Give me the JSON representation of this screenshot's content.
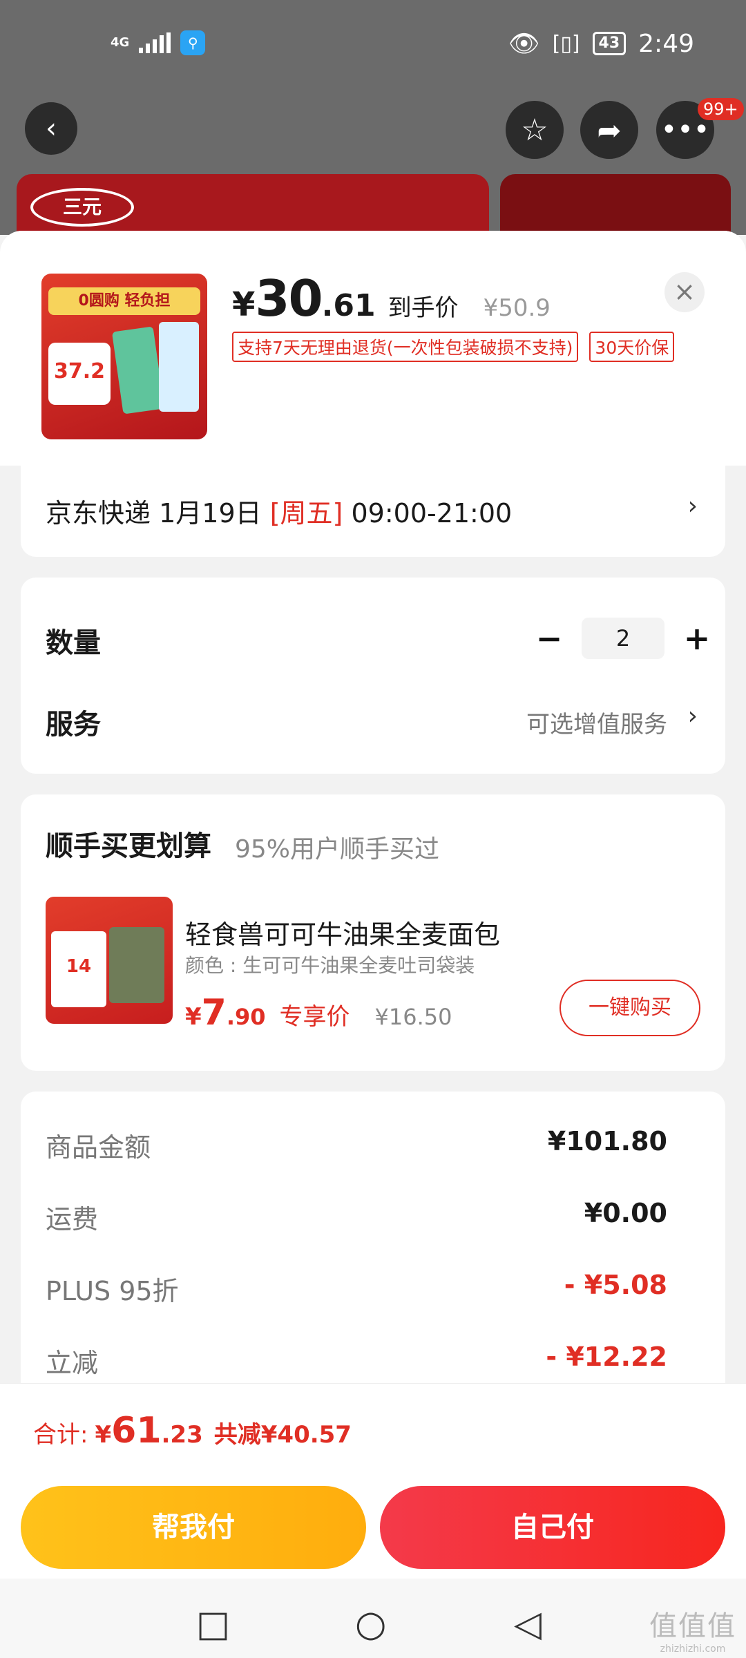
{
  "status": {
    "network": "4G",
    "battery": "43",
    "time": "2:49"
  },
  "background": {
    "badge": "99+",
    "brand": "三元"
  },
  "product": {
    "currency": "¥",
    "price_int": "30",
    "price_dec": ".61",
    "price_label": "到手价",
    "original_price": "¥50.9",
    "tags": [
      "支持7天无理由退货(一次性包装破损不支持)",
      "30天价保"
    ],
    "thumb_ribbon": "0圆购 轻负担",
    "thumb_price": "37.2"
  },
  "delivery": {
    "carrier": "京东快递",
    "date": "1月19日",
    "weekday": "[周五]",
    "time_range": "09:00-21:00"
  },
  "quantity": {
    "label": "数量",
    "value": "2",
    "minus": "−",
    "plus": "+"
  },
  "service": {
    "label": "服务",
    "hint": "可选增值服务"
  },
  "upsell": {
    "title": "顺手买更划算",
    "subtitle": "95%用户顺手买过",
    "item": {
      "name": "轻食兽可可牛油果全麦面包",
      "spec": "颜色 : 生可可牛油果全麦吐司袋装",
      "currency": "¥",
      "price_int": "7",
      "price_dec": ".90",
      "price_label": "专享价",
      "original_price": "¥16.50",
      "thumb_price": "14"
    },
    "buy_button": "一键购买"
  },
  "summary": [
    {
      "label": "商品金额",
      "value": "¥101.80",
      "red": false
    },
    {
      "label": "运费",
      "value": "¥0.00",
      "red": false
    },
    {
      "label": "PLUS 95折",
      "value": "- ¥5.08",
      "red": true
    },
    {
      "label": "立减",
      "value": "- ¥12.22",
      "red": true
    }
  ],
  "footer": {
    "total_label": "合计:",
    "currency": "¥",
    "total_int": "61",
    "total_dec": ".23",
    "saving": "共减¥40.57",
    "help_pay": "帮我付",
    "self_pay": "自己付"
  },
  "watermark": {
    "main": "值值值",
    "url": "zhizhizhi.com"
  },
  "colors": {
    "accent": "#e02e24",
    "help_button": "#ffb812",
    "self_button": "#f5302f"
  }
}
